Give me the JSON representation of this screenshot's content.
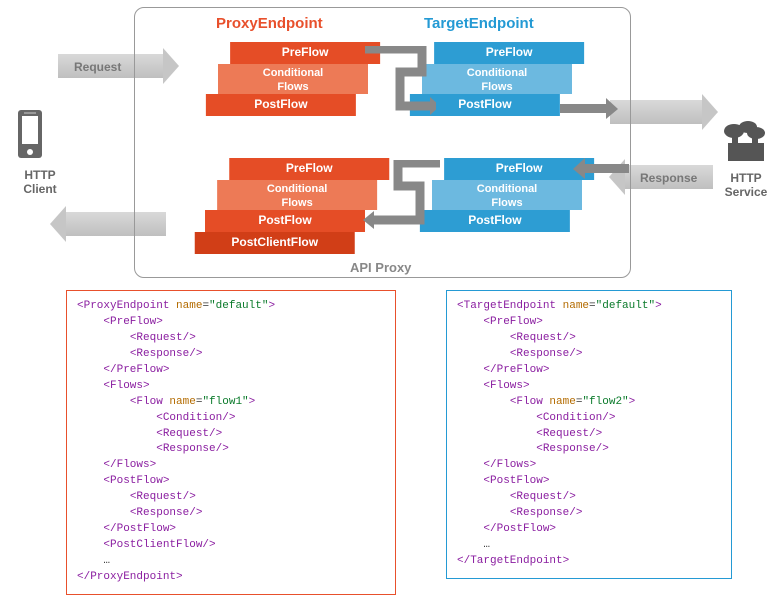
{
  "titles": {
    "proxy": "ProxyEndpoint",
    "target": "TargetEndpoint",
    "api": "API Proxy"
  },
  "labels": {
    "request": "Request",
    "response": "Response",
    "client": "HTTP\nClient",
    "service": "HTTP\nService"
  },
  "flows": {
    "pre": "PreFlow",
    "cond": "Conditional\nFlows",
    "post": "PostFlow",
    "postClient": "PostClientFlow"
  },
  "code": {
    "proxy": {
      "open": "<ProxyEndpoint name=\"default\">",
      "flowName": "flow1",
      "close": "</ProxyEndpoint>",
      "hasPostClient": true
    },
    "target": {
      "open": "<TargetEndpoint name=\"default\">",
      "flowName": "flow2",
      "close": "</TargetEndpoint>",
      "hasPostClient": false
    }
  }
}
